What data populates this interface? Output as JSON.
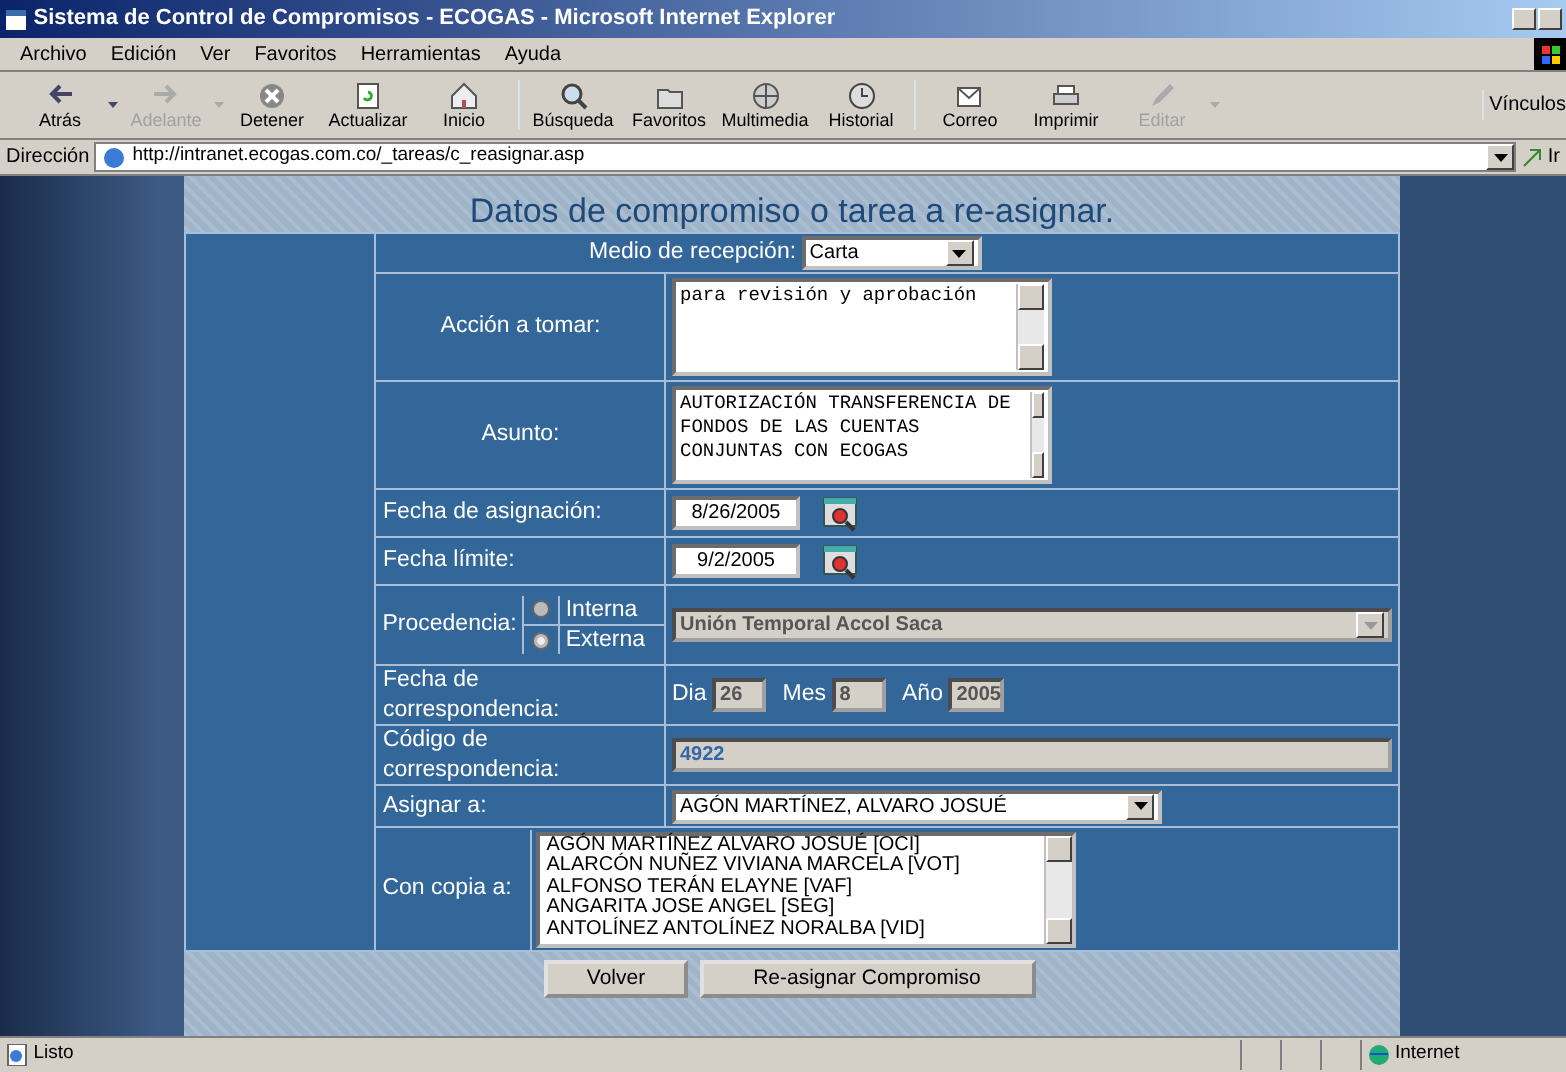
{
  "window": {
    "title": "Sistema de Control de Compromisos - ECOGAS - Microsoft Internet Explorer"
  },
  "menu": [
    "Archivo",
    "Edición",
    "Ver",
    "Favoritos",
    "Herramientas",
    "Ayuda"
  ],
  "toolbar": [
    {
      "label": "Atrás",
      "disabled": false,
      "dropdown": true
    },
    {
      "label": "Adelante",
      "disabled": true,
      "dropdown": true
    },
    {
      "label": "Detener",
      "disabled": false,
      "dropdown": false
    },
    {
      "label": "Actualizar",
      "disabled": false,
      "dropdown": false
    },
    {
      "label": "Inicio",
      "disabled": false,
      "dropdown": false
    },
    {
      "label": "Búsqueda",
      "disabled": false,
      "dropdown": false
    },
    {
      "label": "Favoritos",
      "disabled": false,
      "dropdown": false
    },
    {
      "label": "Multimedia",
      "disabled": false,
      "dropdown": false
    },
    {
      "label": "Historial",
      "disabled": false,
      "dropdown": false
    },
    {
      "label": "Correo",
      "disabled": false,
      "dropdown": false
    },
    {
      "label": "Imprimir",
      "disabled": false,
      "dropdown": false
    },
    {
      "label": "Editar",
      "disabled": true,
      "dropdown": true
    }
  ],
  "links_label": "Vínculos",
  "address": {
    "label": "Dirección",
    "url": "http://intranet.ecogas.com.co/_tareas/c_reasignar.asp",
    "go": "Ir"
  },
  "form": {
    "title": "Datos de compromiso o tarea a re-asignar.",
    "medio": {
      "label": "Medio de recepción:",
      "value": "Carta"
    },
    "accion": {
      "label": "Acción a tomar:",
      "value": "para revisión y aprobación"
    },
    "asunto": {
      "label": "Asunto:",
      "value": "AUTORIZACIÓN TRANSFERENCIA DE FONDOS DE LAS CUENTAS CONJUNTAS CON ECOGAS"
    },
    "fecha_asignacion": {
      "label": "Fecha de asignación:",
      "value": "8/26/2005"
    },
    "fecha_limite": {
      "label": "Fecha límite:",
      "value": "9/2/2005"
    },
    "procedencia": {
      "label": "Procedencia:",
      "options": [
        {
          "label": "Interna",
          "selected": false,
          "disabled": true
        },
        {
          "label": "Externa",
          "selected": true,
          "disabled": true
        }
      ],
      "value": "Unión Temporal Accol Saca",
      "disabled": true
    },
    "fecha_correspondencia": {
      "label": "Fecha de correspondencia:",
      "parts": [
        {
          "label": "Dia",
          "value": "26"
        },
        {
          "label": "Mes",
          "value": "8"
        },
        {
          "label": "Año",
          "value": "2005"
        }
      ],
      "disabled": true
    },
    "codigo": {
      "label": "Código de correspondencia:",
      "value": "4922",
      "disabled": true
    },
    "asignar": {
      "label": "Asignar a:",
      "value": "AGÓN MARTÍNEZ, ALVARO JOSUÉ"
    },
    "copia": {
      "label": "Con copia a:",
      "items": [
        "AGÓN MARTÍNEZ ALVARO JOSUÉ [OCI]",
        "ALARCÓN NUÑEZ VIVIANA MARCELA [VOT]",
        "ALFONSO TERÁN ELAYNE [VAF]",
        "ANGARITA JOSE ANGEL [SEG]",
        "ANTOLÍNEZ ANTOLÍNEZ NORALBA [VID]"
      ]
    },
    "buttons": [
      "Volver",
      "Re-asignar Compromiso"
    ]
  },
  "status_bar": {
    "text": "Listo",
    "zone": "Internet"
  }
}
